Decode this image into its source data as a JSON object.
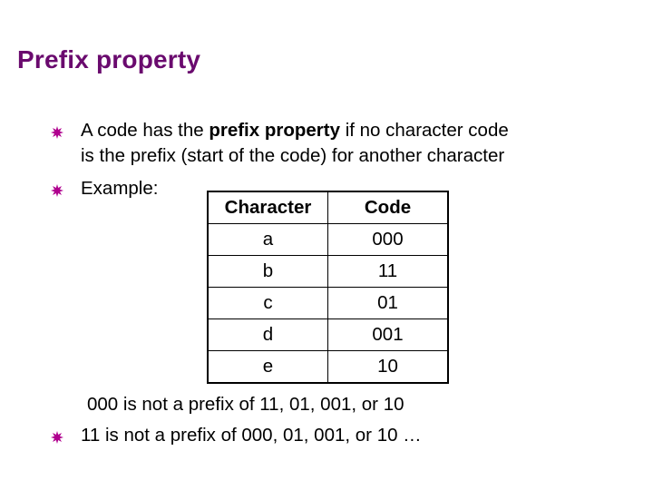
{
  "slide": {
    "title": "Prefix property",
    "bullets": [
      {
        "icon": "starburst-bullet-icon",
        "prefix": "A code has the ",
        "bold": "prefix property",
        "suffix": " if no character code",
        "line2": "is the prefix (start of the code) for another character"
      },
      {
        "icon": "starburst-bullet-icon",
        "text": "Example:"
      }
    ],
    "note_line": "000 is not a prefix of 11, 01, 001, or 10",
    "last_bullet": {
      "icon": "starburst-bullet-icon",
      "text": "11 is not a prefix of 000, 01, 001, or 10  …"
    },
    "bullet_color": "#b0008f",
    "title_color": "#6a0a6e"
  },
  "table": {
    "headers": [
      "Character",
      "Code"
    ],
    "rows": [
      [
        "a",
        "000"
      ],
      [
        "b",
        "11"
      ],
      [
        "c",
        "01"
      ],
      [
        "d",
        "001"
      ],
      [
        "e",
        "10"
      ]
    ]
  }
}
